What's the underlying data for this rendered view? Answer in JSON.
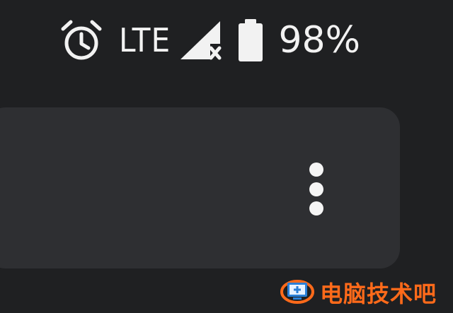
{
  "status_bar": {
    "network_type": "LTE",
    "battery_percent": "98%",
    "icons": [
      "alarm-icon",
      "signal-no-data-icon",
      "battery-icon"
    ]
  },
  "card": {
    "menu_icon": "more-vertical-icon"
  },
  "watermark": {
    "text": "电脑技术吧"
  },
  "colors": {
    "background": "#1f2022",
    "card": "#2e2f32",
    "foreground": "#f2f2f2",
    "watermark_accent": "#ff6a1a",
    "watermark_blue": "#2a7fd6"
  }
}
